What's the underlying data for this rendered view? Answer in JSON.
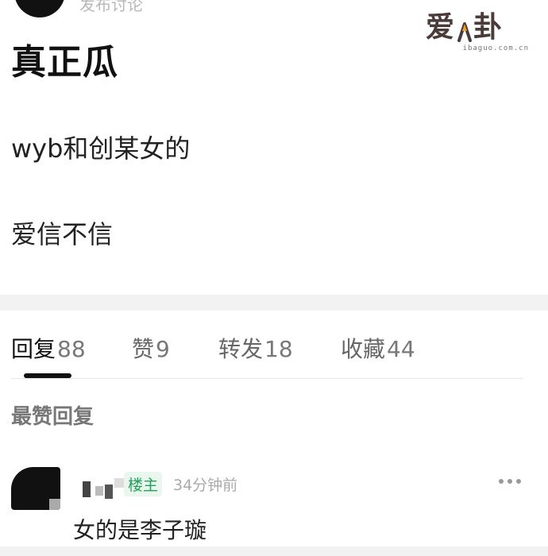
{
  "header": {
    "partial_meta": "发布讨论"
  },
  "watermark": {
    "main_left": "爱",
    "main_right": "卦",
    "site": "ibaguo.com.cn"
  },
  "post": {
    "title": "真正瓜",
    "lines": [
      "wyb和创某女的",
      "爱信不信"
    ]
  },
  "tabs": [
    {
      "label": "回复",
      "count": "88",
      "active": true
    },
    {
      "label": "赞",
      "count": "9",
      "active": false
    },
    {
      "label": "转发",
      "count": "18",
      "active": false
    },
    {
      "label": "收藏",
      "count": "44",
      "active": false
    }
  ],
  "replies": {
    "heading": "最赞回复",
    "items": [
      {
        "badge": "楼主",
        "time": "34分钟前",
        "text": "女的是李子璇",
        "more_icon": "more-horizontal-icon"
      }
    ]
  }
}
